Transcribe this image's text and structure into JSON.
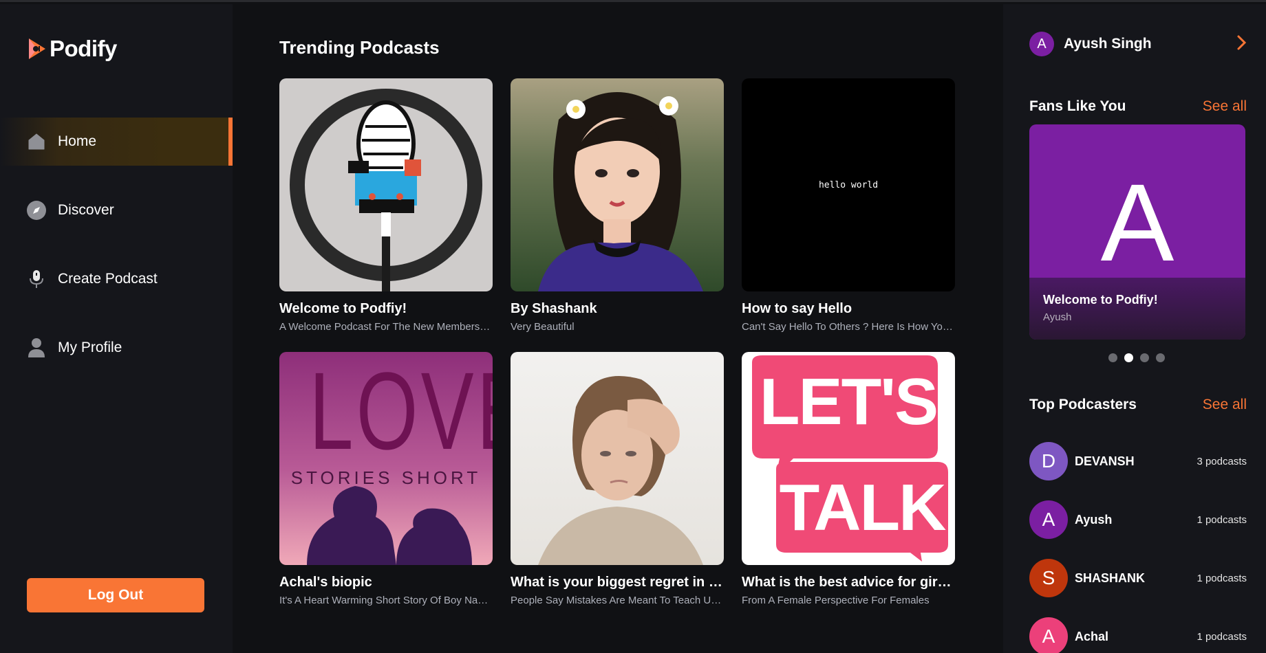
{
  "app": {
    "name": "Podify"
  },
  "sidebar": {
    "nav": [
      {
        "label": "Home",
        "icon": "home-icon",
        "active": true
      },
      {
        "label": "Discover",
        "icon": "compass-icon",
        "active": false
      },
      {
        "label": "Create Podcast",
        "icon": "microphone-icon",
        "active": false
      },
      {
        "label": "My Profile",
        "icon": "user-icon",
        "active": false
      }
    ],
    "logout_label": "Log Out"
  },
  "main": {
    "section_title": "Trending Podcasts",
    "podcasts": [
      {
        "title": "Welcome to Podfiy!",
        "description": "A Welcome Podcast For The New Members Of Podify",
        "thumb": "microphone-illustration"
      },
      {
        "title": "By Shashank",
        "description": "Very Beautiful",
        "thumb": "portrait-girl-flowers"
      },
      {
        "title": "How to say Hello",
        "description": "Can't Say Hello To Others ? Here Is How You Can Do It",
        "thumb": "hello-world-text",
        "thumb_text": "hello world"
      },
      {
        "title": "Achal's biopic",
        "description": "It's A Heart Warming Short Story Of Boy Named Achal",
        "thumb": "love-stories-poster",
        "thumb_text_main": "LOVE",
        "thumb_text_sub": "STORIES SHORT"
      },
      {
        "title": "What is your biggest regret in life?",
        "description": "People Say Mistakes Are Meant To Teach Us Something",
        "thumb": "worried-woman-photo"
      },
      {
        "title": "What is the best advice for girls?",
        "description": "From A Female Perspective For Females",
        "thumb": "lets-talk-bubbles",
        "thumb_text_main": "LET'S",
        "thumb_text_sub": "TALK"
      }
    ]
  },
  "right": {
    "user": {
      "initial": "A",
      "name": "Ayush Singh"
    },
    "fans": {
      "title": "Fans Like You",
      "see_all": "See all",
      "card": {
        "initial": "A",
        "title": "Welcome to Podfiy!",
        "author": "Ayush"
      },
      "slides": 4,
      "active_slide": 2
    },
    "top_podcasters": {
      "title": "Top Podcasters",
      "see_all": "See all",
      "items": [
        {
          "initial": "D",
          "name": "DEVANSH",
          "count": "3 podcasts",
          "color": "#7e57c2"
        },
        {
          "initial": "A",
          "name": "Ayush",
          "count": "1 podcasts",
          "color": "#7b1fa2"
        },
        {
          "initial": "S",
          "name": "SHASHANK",
          "count": "1 podcasts",
          "color": "#bf360c"
        },
        {
          "initial": "A",
          "name": "Achal",
          "count": "1 podcasts",
          "color": "#ec407a"
        }
      ]
    }
  },
  "colors": {
    "accent": "#f97535",
    "background": "#101114",
    "panel": "#15161b"
  }
}
